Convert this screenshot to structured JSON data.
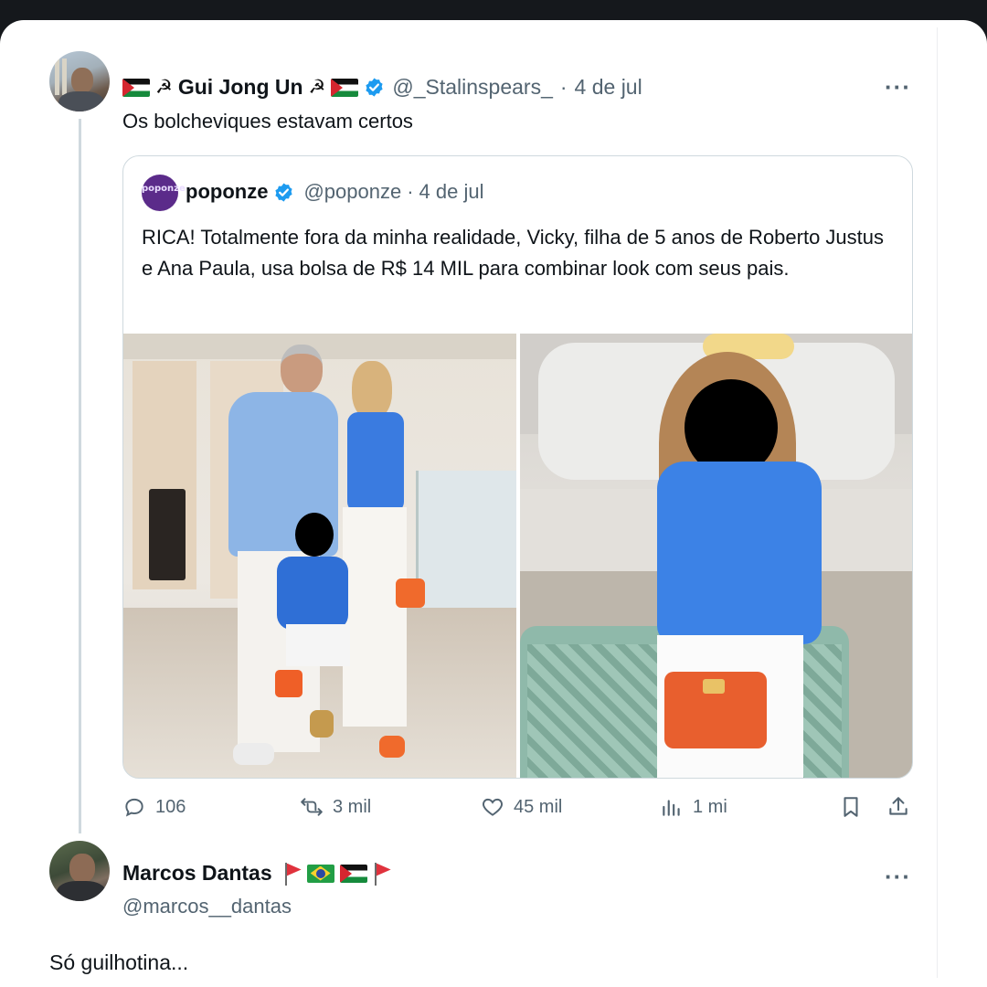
{
  "tweet": {
    "author_name": "Gui Jong Un",
    "author_prefix_icons": [
      "palestine-flag",
      "hammer-sickle"
    ],
    "author_suffix_icons": [
      "hammer-sickle",
      "palestine-flag",
      "verified-badge"
    ],
    "handle": "@_Stalinspears_",
    "separator": "·",
    "date": "4 de jul",
    "more": "···",
    "text": "Os bolcheviques estavam certos",
    "quote": {
      "avatar_text": "poponze",
      "author_name": "poponze",
      "handle": "@poponze",
      "separator": "·",
      "date": "4 de jul",
      "text": "RICA! Totalmente fora da minha realidade, Vicky, filha de 5 anos de Roberto Justus e Ana Paula, usa bolsa de R$ 14 MIL para combinar look com seus pais.",
      "photos": [
        "family-photo",
        "child-with-orange-bag-photo"
      ]
    },
    "actions": {
      "replies": "106",
      "reposts": "3 mil",
      "likes": "45 mil",
      "views": "1 mi"
    }
  },
  "reply": {
    "author_name": "Marcos Dantas",
    "author_suffix_icons": [
      "red-flag",
      "brazil-flag",
      "palestine-flag",
      "red-flag"
    ],
    "handle": "@marcos__dantas",
    "more": "···",
    "text": "Só guilhotina..."
  },
  "colors": {
    "text": "#0f1419",
    "secondary": "#536471",
    "verified": "#1d9bf0",
    "border": "#cfd9de"
  }
}
